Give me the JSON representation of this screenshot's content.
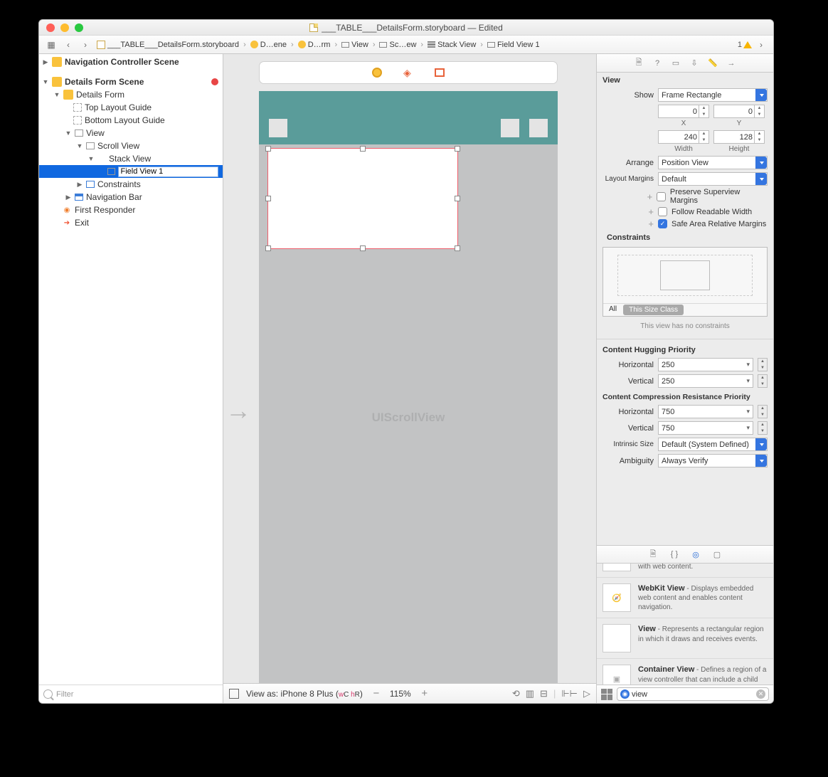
{
  "window": {
    "title": "___TABLE___DetailsForm.storyboard — Edited"
  },
  "jumpbar": [
    "___TABLE___DetailsForm.storyboard",
    "D…ene",
    "D…rm",
    "View",
    "Sc…ew",
    "Stack View",
    "Field View 1"
  ],
  "jump_count": "1",
  "outline": {
    "nav_scene": "Navigation Controller Scene",
    "details_scene": "Details Form Scene",
    "details_form": "Details Form",
    "top_guide": "Top Layout Guide",
    "bottom_guide": "Bottom Layout Guide",
    "view": "View",
    "scroll_view": "Scroll View",
    "stack_view": "Stack View",
    "field_view": "Field View 1",
    "constraints": "Constraints",
    "nav_bar": "Navigation Bar",
    "first_responder": "First Responder",
    "exit": "Exit",
    "filter_placeholder": "Filter"
  },
  "canvas": {
    "scroll_label": "UIScrollView",
    "view_as": "View as: iPhone 8 Plus (",
    "wc_w": "w",
    "wc_c": "C ",
    "wc_h": "h",
    "wc_r": "R",
    "view_as_close": ")",
    "zoom": "115%"
  },
  "inspector": {
    "section_view": "View",
    "show_label": "Show",
    "show_value": "Frame Rectangle",
    "x_label": "X",
    "y_label": "Y",
    "x_val": "0",
    "y_val": "0",
    "w_label": "Width",
    "h_label": "Height",
    "w_val": "240",
    "h_val": "128",
    "arrange_label": "Arrange",
    "arrange_value": "Position View",
    "margins_label": "Layout Margins",
    "margins_value": "Default",
    "chk1": "Preserve Superview Margins",
    "chk2": "Follow Readable Width",
    "chk3": "Safe Area Relative Margins",
    "constraints_title": "Constraints",
    "con_all": "All",
    "con_this": "This Size Class",
    "con_msg": "This view has no constraints",
    "hug_title": "Content Hugging Priority",
    "horiz": "Horizontal",
    "vert": "Vertical",
    "hug_h": "250",
    "hug_v": "250",
    "comp_title": "Content Compression Resistance Priority",
    "comp_h": "750",
    "comp_v": "750",
    "intrinsic_label": "Intrinsic Size",
    "intrinsic_value": "Default (System Defined)",
    "ambig_label": "Ambiguity",
    "ambig_value": "Always Verify"
  },
  "library": {
    "item0_tail": "with web content.",
    "item1_title": "WebKit View",
    "item1_desc": " - Displays embedded web content and enables content navigation.",
    "item2_title": "View",
    "item2_desc": " - Represents a rectangular region in which it draws and receives events.",
    "item3_title": "Container View",
    "item3_desc": " - Defines a region of a view controller that can include a child view controller.",
    "search_value": "view"
  }
}
